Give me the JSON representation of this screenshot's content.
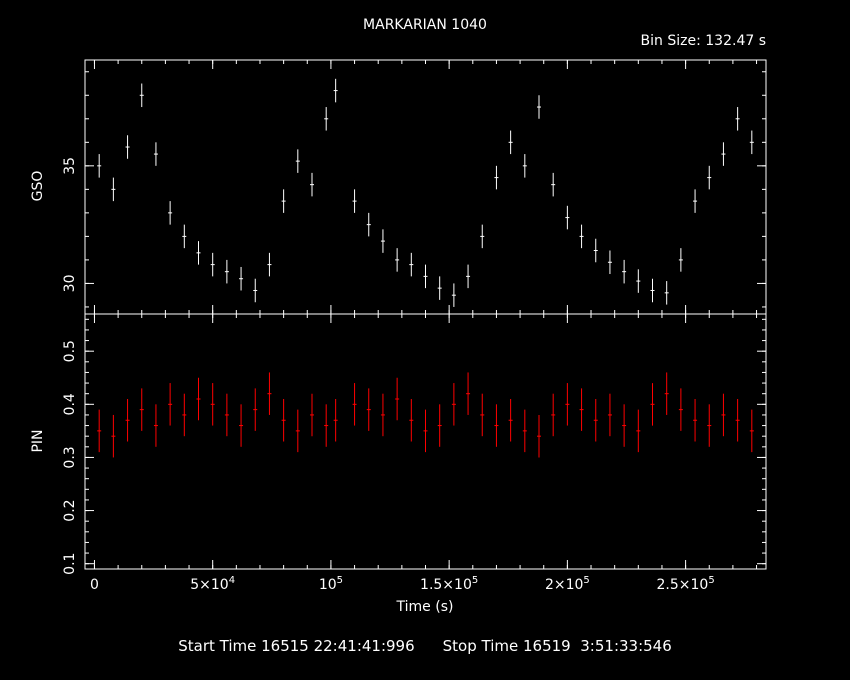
{
  "chart_data": {
    "type": "scatter",
    "title": "MARKARIAN 1040",
    "bin_size_label": "Bin Size: 132.47 s",
    "xlabel": "Time (s)",
    "xlim": [
      -4000,
      284000
    ],
    "x_tick_values": [
      0,
      50000,
      100000,
      150000,
      200000,
      250000
    ],
    "x_tick_labels": [
      {
        "mant": "0",
        "exp": ""
      },
      {
        "mant": "5×10",
        "exp": "4"
      },
      {
        "mant": "10",
        "exp": "5"
      },
      {
        "mant": "1.5×10",
        "exp": "5"
      },
      {
        "mant": "2×10",
        "exp": "5"
      },
      {
        "mant": "2.5×10",
        "exp": "5"
      }
    ],
    "panels": [
      {
        "name": "GSO",
        "ylabel": "GSO",
        "color": "#ffffff",
        "ylim": [
          28.7,
          39.5
        ],
        "y_ticks": [
          30,
          35
        ],
        "y_tick_labels": [
          "30",
          "35"
        ],
        "series": [
          {
            "x": [
              2000,
              8000,
              14000,
              20000,
              26000,
              32000,
              38000,
              44000,
              50000,
              56000,
              62000,
              68000,
              74000,
              80000,
              86000,
              92000,
              98000,
              102000,
              110000,
              116000,
              122000,
              128000,
              134000,
              140000,
              146000,
              152000,
              158000,
              164000,
              170000,
              176000,
              182000,
              188000,
              194000,
              200000,
              206000,
              212000,
              218000,
              224000,
              230000,
              236000,
              242000,
              248000,
              254000,
              260000,
              266000,
              272000,
              278000
            ],
            "y": [
              35.0,
              34.0,
              35.8,
              38.0,
              35.5,
              33.0,
              32.0,
              31.3,
              30.8,
              30.5,
              30.2,
              29.7,
              30.8,
              33.5,
              35.2,
              34.2,
              37.0,
              38.2,
              33.5,
              32.5,
              31.8,
              31.0,
              30.8,
              30.3,
              29.8,
              29.5,
              30.3,
              32.0,
              34.5,
              36.0,
              35.0,
              37.5,
              34.2,
              32.8,
              32.0,
              31.4,
              30.9,
              30.5,
              30.1,
              29.7,
              29.6,
              31.0,
              33.5,
              34.5,
              35.5,
              37.0,
              36.0
            ]
          }
        ]
      },
      {
        "name": "PIN",
        "ylabel": "PIN",
        "color": "#ff0000",
        "ylim": [
          0.09,
          0.57
        ],
        "y_ticks": [
          0.1,
          0.2,
          0.3,
          0.4,
          0.5
        ],
        "y_tick_labels": [
          "0.1",
          "0.2",
          "0.3",
          "0.4",
          "0.5"
        ],
        "series": [
          {
            "x": [
              2000,
              8000,
              14000,
              20000,
              26000,
              32000,
              38000,
              44000,
              50000,
              56000,
              62000,
              68000,
              74000,
              80000,
              86000,
              92000,
              98000,
              102000,
              110000,
              116000,
              122000,
              128000,
              134000,
              140000,
              146000,
              152000,
              158000,
              164000,
              170000,
              176000,
              182000,
              188000,
              194000,
              200000,
              206000,
              212000,
              218000,
              224000,
              230000,
              236000,
              242000,
              248000,
              254000,
              260000,
              266000,
              272000,
              278000
            ],
            "y": [
              0.35,
              0.34,
              0.37,
              0.39,
              0.36,
              0.4,
              0.38,
              0.41,
              0.4,
              0.38,
              0.36,
              0.39,
              0.42,
              0.37,
              0.35,
              0.38,
              0.36,
              0.37,
              0.4,
              0.39,
              0.38,
              0.41,
              0.37,
              0.35,
              0.36,
              0.4,
              0.42,
              0.38,
              0.36,
              0.37,
              0.35,
              0.34,
              0.38,
              0.4,
              0.39,
              0.37,
              0.38,
              0.36,
              0.35,
              0.4,
              0.42,
              0.39,
              0.37,
              0.36,
              0.38,
              0.37,
              0.35
            ]
          }
        ]
      }
    ],
    "start_time": "Start Time 16515 22:41:41:996",
    "stop_time": "Stop Time 16519  3:51:33:546"
  }
}
